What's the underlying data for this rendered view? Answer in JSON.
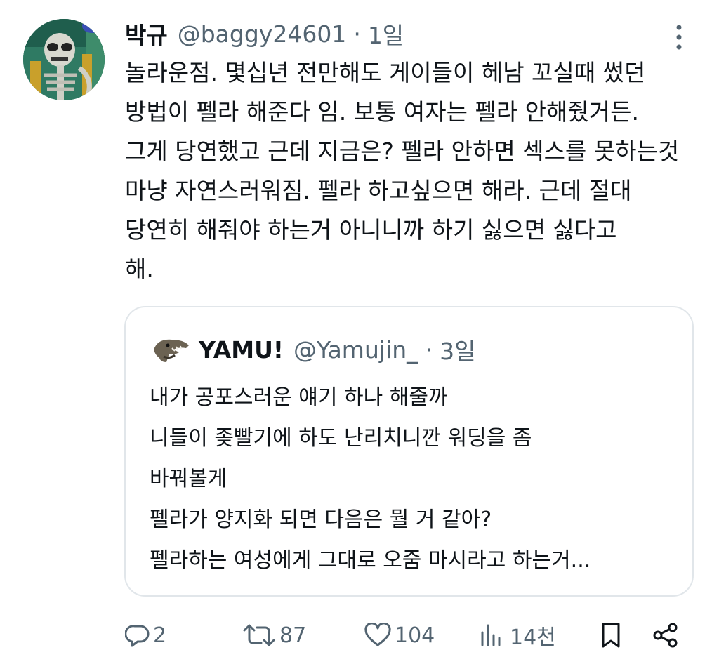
{
  "post": {
    "author_name": "박규",
    "author_handle": "@baggy24601",
    "separator": "·",
    "time": "1일",
    "lines": [
      "놀라운점. 몇십년 전만해도 게이들이 헤남 꼬실때 썼던",
      "방법이 펠라 해준다 임. 보통 여자는 펠라 안해줬거든.",
      "그게 당연했고 근데 지금은? 펠라 안하면 섹스를 못하는것",
      "마냥 자연스러워짐. 펠라 하고싶으면 해라. 근데 절대",
      "당연히 해줘야 하는거 아니니까 하기 싫으면 싫다고",
      "해."
    ]
  },
  "quote": {
    "author_name": "YAMU!",
    "author_handle": "@Yamujin_",
    "separator": "·",
    "time": "3일",
    "lines": [
      "내가 공포스러운 얘기 하나 해줄까",
      "니들이 좆빨기에 하도 난리치니깐 워딩을 좀",
      "바꿔볼게",
      "펠라가 양지화 되면 다음은 뭘 거 같아?",
      "펠라하는 여성에게 그대로 오줌 마시라고 하는거..."
    ]
  },
  "actions": {
    "reply_count": "2",
    "retweet_count": "87",
    "like_count": "104",
    "view_count": "14천"
  },
  "icons": {
    "more": "more-vertical-icon",
    "reply": "reply-icon",
    "retweet": "retweet-icon",
    "like": "heart-icon",
    "views": "views-icon",
    "bookmark": "bookmark-icon",
    "share": "share-icon"
  },
  "colors": {
    "text": "#0f1419",
    "secondary": "#536471",
    "border": "#e1e6ea"
  }
}
